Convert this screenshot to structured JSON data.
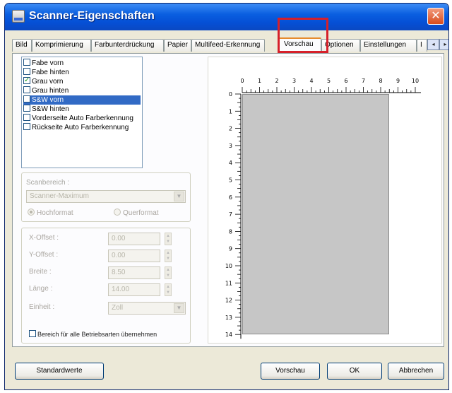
{
  "window": {
    "title": "Scanner-Eigenschaften",
    "close_glyph": "✕"
  },
  "tabs": [
    {
      "label": "Bild"
    },
    {
      "label": "Komprimierung"
    },
    {
      "label": "Farbunterdrückung"
    },
    {
      "label": "Papier"
    },
    {
      "label": "Multifeed-Erkennung"
    },
    {
      "label": "Vorschau",
      "active": true
    },
    {
      "label": "Optionen"
    },
    {
      "label": "Einstellungen"
    },
    {
      "label": "I"
    }
  ],
  "tab_scroll": {
    "left": "◂",
    "right": "▸"
  },
  "image_list": [
    {
      "label": "Fabe vorn",
      "checked": false,
      "selected": false
    },
    {
      "label": "Fabe hinten",
      "checked": false,
      "selected": false
    },
    {
      "label": "Grau vorn",
      "checked": true,
      "selected": false
    },
    {
      "label": "Grau hinten",
      "checked": false,
      "selected": false
    },
    {
      "label": "S&W vorn",
      "checked": false,
      "selected": true
    },
    {
      "label": "S&W hinten",
      "checked": false,
      "selected": false
    },
    {
      "label": "Vorderseite Auto Farberkennung",
      "checked": false,
      "selected": false
    },
    {
      "label": "Rückseite Auto Farberkennung",
      "checked": false,
      "selected": false
    }
  ],
  "scan_area": {
    "label": "Scanbereich :",
    "selected": "Scanner-Maximum",
    "orientation_portrait": "Hochformat",
    "orientation_landscape": "Querformat",
    "portrait_selected": true
  },
  "fields": [
    {
      "label": "X-Offset :",
      "value": "0.00"
    },
    {
      "label": "Y-Offset :",
      "value": "0.00"
    },
    {
      "label": "Breite :",
      "value": "8.50"
    },
    {
      "label": "Länge :",
      "value": "14.00"
    }
  ],
  "unit": {
    "label": "Einheit :",
    "value": "Zoll"
  },
  "apply_all_label": "Bereich für alle Betriebsarten übernehmen",
  "ruler": {
    "x_ticks": [
      "0",
      "1",
      "2",
      "3",
      "4",
      "5",
      "6",
      "7",
      "8",
      "9",
      "10"
    ],
    "y_ticks": [
      "0",
      "1",
      "2",
      "3",
      "4",
      "5",
      "6",
      "7",
      "8",
      "9",
      "10",
      "11",
      "12",
      "13",
      "14"
    ]
  },
  "scan_area_size": {
    "width_in": 8.5,
    "length_in": 14
  },
  "buttons": {
    "defaults": "Standardwerte",
    "preview": "Vorschau",
    "ok": "OK",
    "cancel": "Abbrechen"
  }
}
